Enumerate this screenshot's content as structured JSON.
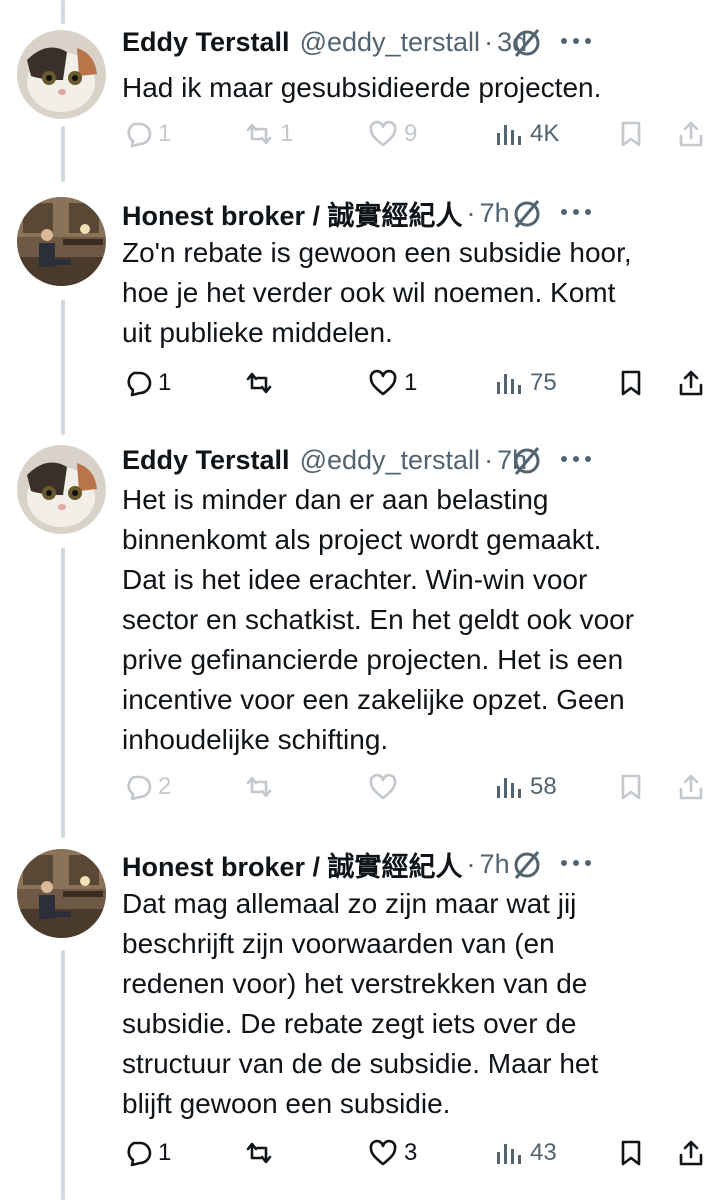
{
  "tweets": [
    {
      "name": "Eddy Terstall",
      "handle": "@eddy_terstall",
      "time": "3d",
      "text": "Had ik maar gesubsidieerde projecten.",
      "replies": "1",
      "retweets": "1",
      "likes": "9",
      "views": "4K"
    },
    {
      "name": "Honest broker / 誠實經紀人",
      "handle": "",
      "time": "7h",
      "text": "Zo'n rebate is gewoon een subsidie hoor,\nhoe je het verder ook wil noemen. Komt\nuit publieke middelen.",
      "replies": "1",
      "retweets": "",
      "likes": "1",
      "views": "75"
    },
    {
      "name": "Eddy Terstall",
      "handle": "@eddy_terstall",
      "time": "7h",
      "text": "Het is minder dan er aan belasting\nbinnenkomt als project wordt gemaakt.\nDat is het idee erachter. Win-win voor\nsector en schatkist. En het geldt ook voor\nprive gefinancierde projecten. Het is een\nincentive voor een zakelijke opzet. Geen\ninhoudelijke schifting.",
      "replies": "2",
      "retweets": "",
      "likes": "",
      "views": "58"
    },
    {
      "name": "Honest broker / 誠實經紀人",
      "handle": "",
      "time": "7h",
      "text": "Dat mag allemaal zo zijn maar wat jij\nbeschrijft zijn voorwaarden van (en\nredenen voor) het verstrekken van de\nsubsidie. De rebate zegt iets over de\nstructuur van de de subsidie. Maar het\nblijft gewoon een subsidie.",
      "replies": "1",
      "retweets": "",
      "likes": "3",
      "views": "43"
    }
  ],
  "separator": "·",
  "icons": [
    "reply-icon",
    "retweet-icon",
    "like-icon",
    "views-icon",
    "bookmark-icon",
    "share-icon",
    "grok-icon",
    "more-icon"
  ],
  "colors": {
    "text": "#0f1419",
    "secondary": "#536471",
    "thread_line": "#cfd9de"
  }
}
